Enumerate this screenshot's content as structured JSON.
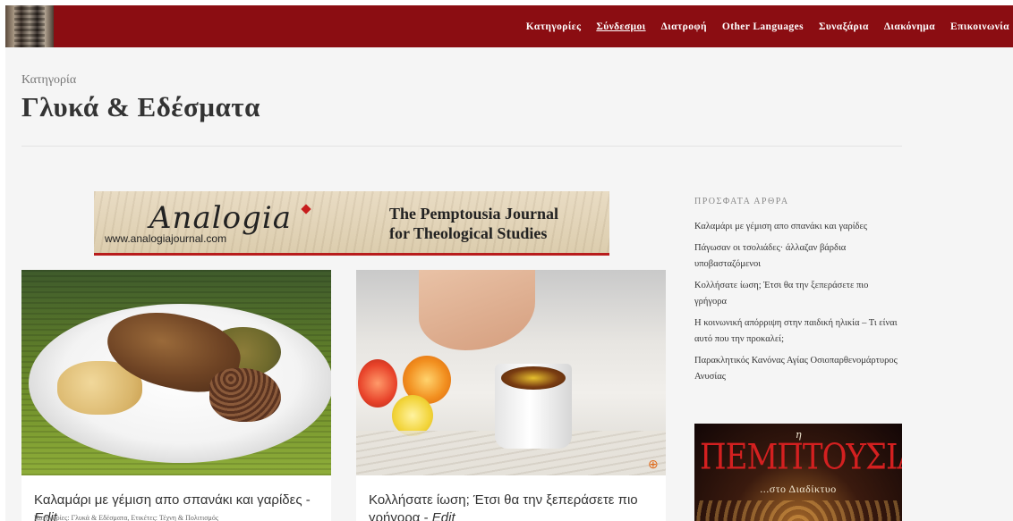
{
  "nav": {
    "items": [
      {
        "label": "Κατηγορίες",
        "active": false
      },
      {
        "label": "Σύνδεσμοι",
        "active": true
      },
      {
        "label": "Διατροφή",
        "active": false
      },
      {
        "label": "Other Languages",
        "active": false
      },
      {
        "label": "Συναξάρια",
        "active": false
      },
      {
        "label": "Διακόνημα",
        "active": false
      },
      {
        "label": "Επικοινωνία",
        "active": false
      }
    ],
    "bar_color": "#8b0d12"
  },
  "header": {
    "category_label": "Κατηγορία",
    "category_title": "Γλυκά & Εδέσματα"
  },
  "banner": {
    "logo_text": "Analogia",
    "url": "www.analogiajournal.com",
    "journal_line1": "The Pemptousia Journal",
    "journal_line2": "for Theological Studies"
  },
  "posts": [
    {
      "title": "Καλαμάρι με γέμιση απο σπανάκι και γαρίδες",
      "edit": "Edit",
      "meta": "Κατηγορίες: Γλυκά & Εδέσματα, Ετικέτες: Τέχνη & Πολιτισμός"
    },
    {
      "title": "Κολλήσατε ίωση; Έτσι θα την ξεπεράσετε πιο γρήγορα",
      "edit": "Edit"
    }
  ],
  "sidebar": {
    "heading": "ΠΡΟΣΦΑΤΑ ΑΡΘΡΑ",
    "recent": [
      "Καλαμάρι με γέμιση απο σπανάκι και γαρίδες",
      "Πάγωσαν οι τσολιάδες· άλλαζαν βάρδια υποβασταζόμενοι",
      "Κολλήσατε ίωση; Έτσι θα την ξεπεράσετε πιο γρήγορα",
      "Η κοινωνική απόρριψη στην παιδική ηλικία – Τι είναι αυτό που την προκαλεί;",
      "Παρακλητικός Κανόνας Αγίας Οσιοπαρθενομάρτυρος Ανυσίας"
    ],
    "ad": {
      "eta": "η",
      "brand": "ΠΕΜΠΤΟΥΣΙΑ",
      "sub": "...στο Διαδίκτυο"
    }
  }
}
